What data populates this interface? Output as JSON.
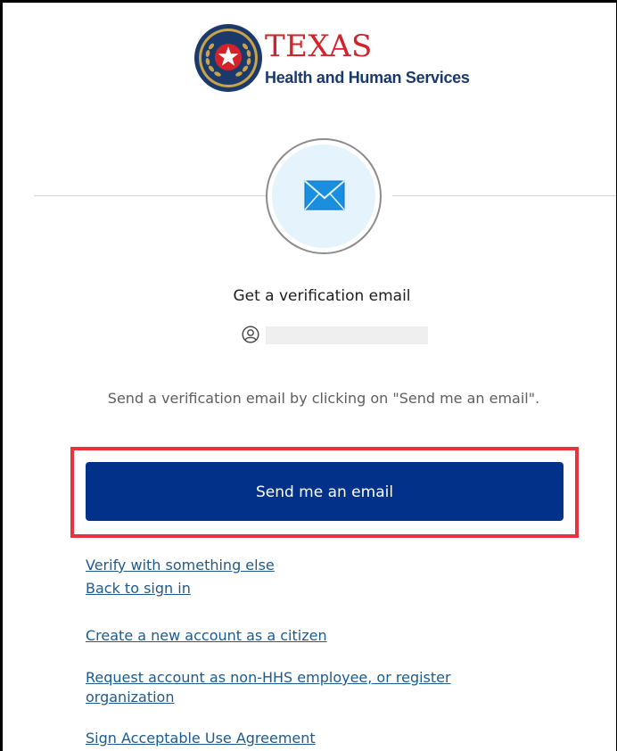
{
  "logo": {
    "title": "TEXAS",
    "subtitle": "Health and Human Services",
    "colors": {
      "title": "#d2232a",
      "subtitle": "#1b3a6b",
      "seal_ring": "#1b3a6b",
      "seal_star_bg": "#d2232a"
    }
  },
  "icon": {
    "name": "envelope-icon"
  },
  "verification": {
    "title": "Get a verification email",
    "user_icon": "user-circle-icon",
    "identifier": "",
    "instructions": "Send a verification email by clicking on \"Send me an email\"."
  },
  "actions": {
    "send_email_label": "Send me an email",
    "highlight_color": "#e8333f",
    "button_color": "#02318a"
  },
  "links": {
    "verify_other": "Verify with something else",
    "back_to_sign_in": "Back to sign in",
    "create_account": "Create a new account as a citizen",
    "request_account": "Request account as non-HHS employee, or register organization",
    "sign_agreement": "Sign Acceptable Use Agreement"
  }
}
